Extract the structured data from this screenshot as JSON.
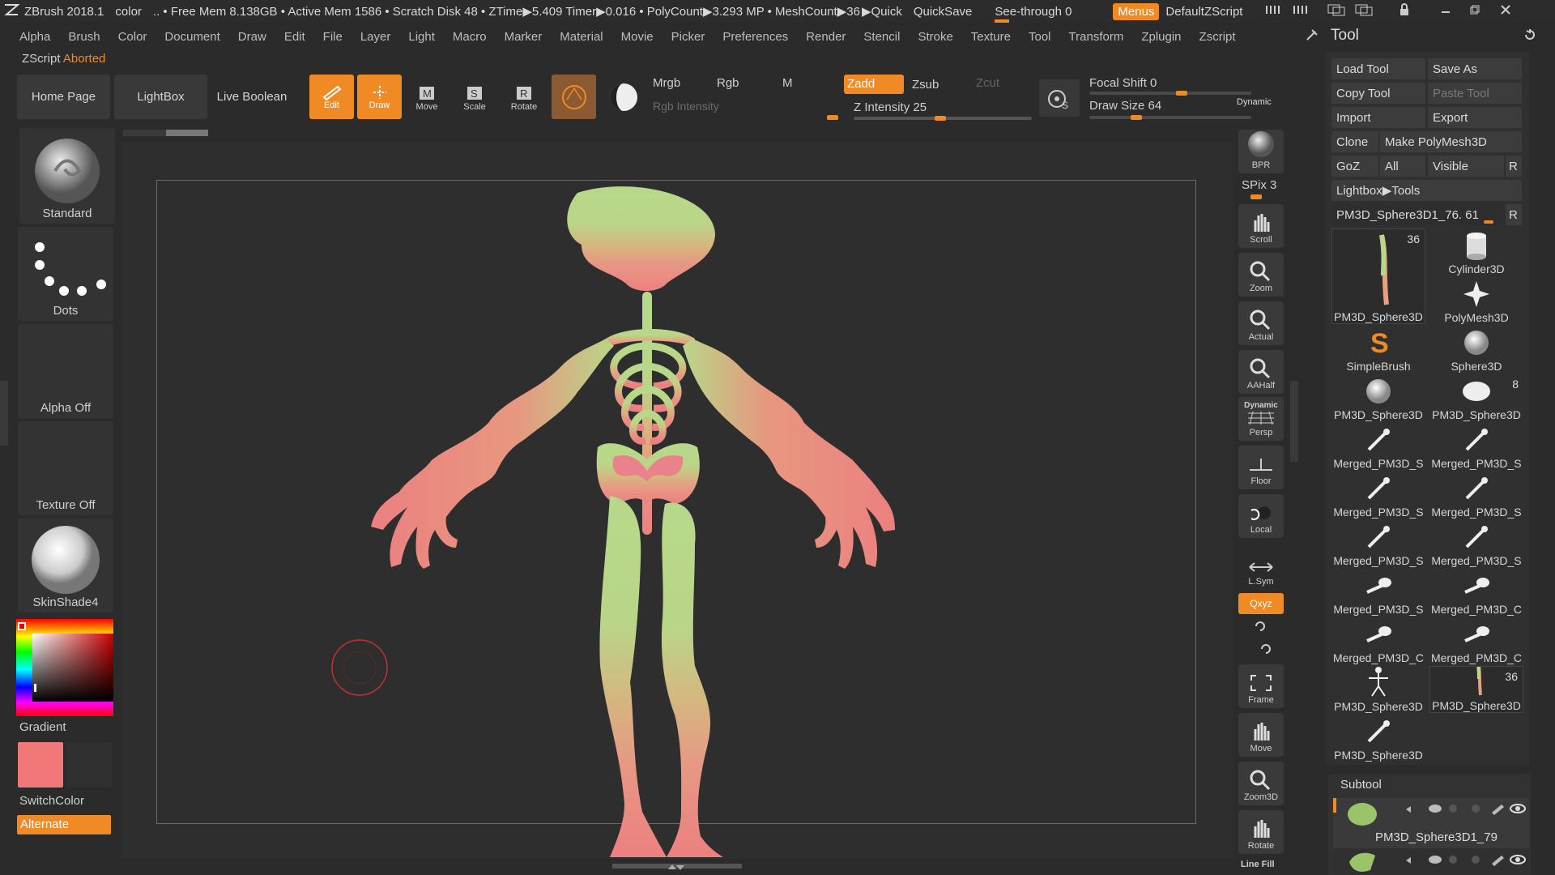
{
  "titlebar": {
    "app": "ZBrush 2018.1",
    "mode": "color",
    "stats": ".. • Free Mem 8.138GB • Active Mem 1586 • Scratch Disk 48 • ZTime▶5.409 Timer▶0.016 • PolyCount▶3.293 MP  • MeshCount▶36",
    "quick": "▶Quick",
    "quicksave": "QuickSave",
    "seethrough": "See-through  0",
    "menus": "Menus",
    "zscript": "DefaultZScript"
  },
  "menubar": [
    "Alpha",
    "Brush",
    "Color",
    "Document",
    "Draw",
    "Edit",
    "File",
    "Layer",
    "Light",
    "Macro",
    "Marker",
    "Material",
    "Movie",
    "Picker",
    "Preferences",
    "Render",
    "Stencil",
    "Stroke",
    "Texture",
    "Tool",
    "Transform",
    "Zplugin",
    "Zscript"
  ],
  "zscript_status": {
    "label": "ZScript",
    "state": "Aborted"
  },
  "top_shelf": {
    "home": "Home Page",
    "lightbox": "LightBox",
    "liveboolean": "Live Boolean",
    "edit": "Edit",
    "draw": "Draw",
    "move": "Move",
    "scale": "Scale",
    "rotate": "Rotate",
    "mrgb": "Mrgb",
    "rgb": "Rgb",
    "m": "M",
    "zadd": "Zadd",
    "zsub": "Zsub",
    "zcut": "Zcut",
    "rgb_intensity": "Rgb Intensity",
    "z_intensity": "Z Intensity 25",
    "focal_shift": "Focal Shift 0",
    "draw_size": "Draw Size 64",
    "dynamic": "Dynamic",
    "slider_levels": {
      "z_intensity": 0.25,
      "focal_shift": 0.5,
      "draw_size": 0.13
    }
  },
  "left_shelf": {
    "brush": "Standard",
    "stroke": "Dots",
    "alpha": "Alpha Off",
    "texture": "Texture Off",
    "material": "SkinShade4",
    "gradient": "Gradient",
    "switchcolor": "SwitchColor",
    "alternate": "Alternate",
    "main_color": "#f07878"
  },
  "right_shelf": {
    "bpr": "BPR",
    "spix": "SPix 3",
    "scroll": "Scroll",
    "zoom": "Zoom",
    "actual": "Actual",
    "aahalf": "AAHalf",
    "dynamic": "Dynamic",
    "persp": "Persp",
    "floor": "Floor",
    "local": "Local",
    "lsym": "L.Sym",
    "xyz": "Qxyz",
    "frame": "Frame",
    "move": "Move",
    "zoom3d": "Zoom3D",
    "rotate": "Rotate",
    "linefill": "Line Fill"
  },
  "tool_panel": {
    "title": "Tool",
    "buttons": [
      [
        "Load Tool",
        "Save As"
      ],
      [
        "Copy Tool",
        "Paste Tool"
      ],
      [
        "Import",
        "Export"
      ]
    ],
    "clone": "Clone",
    "make_polymesh": "Make PolyMesh3D",
    "goz": "GoZ",
    "all": "All",
    "visible": "Visible",
    "r": "R",
    "lightbox_tools": "Lightbox▶Tools",
    "current_tool": "PM3D_Sphere3D1_76. 61",
    "tiles": [
      {
        "label": "PM3D_Sphere3D",
        "count": "36",
        "icon": "figure-thumb"
      },
      {
        "label": "Cylinder3D",
        "count": "",
        "icon": "cylinder-icon"
      },
      {
        "label": "",
        "count": "",
        "icon": ""
      },
      {
        "label": "PolyMesh3D",
        "count": "",
        "icon": "star-icon"
      },
      {
        "label": "SimpleBrush",
        "count": "",
        "icon": "s-brush-icon"
      },
      {
        "label": "Sphere3D",
        "count": "",
        "icon": "sphere-icon"
      },
      {
        "label": "PM3D_Sphere3D",
        "count": "",
        "icon": "sphere-icon"
      },
      {
        "label": "PM3D_Sphere3D",
        "count": "8",
        "icon": "ellipsoid-icon"
      },
      {
        "label": "Merged_PM3D_S",
        "count": "",
        "icon": "bone-icon"
      },
      {
        "label": "Merged_PM3D_S",
        "count": "",
        "icon": "bone-icon"
      },
      {
        "label": "Merged_PM3D_S",
        "count": "",
        "icon": "bone-icon"
      },
      {
        "label": "Merged_PM3D_S",
        "count": "",
        "icon": "bone-icon"
      },
      {
        "label": "Merged_PM3D_S",
        "count": "",
        "icon": "bone-icon"
      },
      {
        "label": "Merged_PM3D_S",
        "count": "",
        "icon": "bone-icon"
      },
      {
        "label": "Merged_PM3D_S",
        "count": "",
        "icon": "joint-icon"
      },
      {
        "label": "Merged_PM3D_C",
        "count": "",
        "icon": "joint-icon"
      },
      {
        "label": "Merged_PM3D_C",
        "count": "",
        "icon": "joint-icon"
      },
      {
        "label": "Merged_PM3D_C",
        "count": "",
        "icon": "joint-icon"
      },
      {
        "label": "PM3D_Sphere3D",
        "count": "",
        "icon": "skeleton-icon"
      },
      {
        "label": "PM3D_Sphere3D",
        "count": "36",
        "icon": "figure-thumb"
      },
      {
        "label": "PM3D_Sphere3D",
        "count": "",
        "icon": "bone-icon"
      }
    ],
    "subtool_title": "Subtool",
    "subtool_name": "PM3D_Sphere3D1_79"
  },
  "colors": {
    "accent": "#f08a24",
    "skeleton_top": "#b7d88a",
    "skeleton_bottom": "#ec8080"
  }
}
